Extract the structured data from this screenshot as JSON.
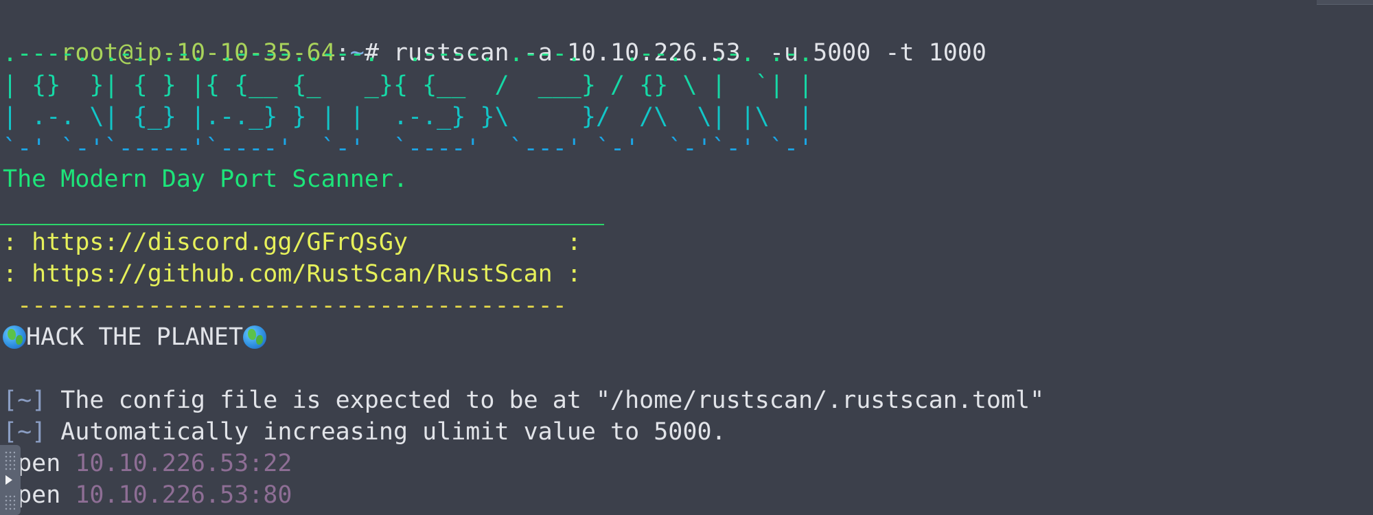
{
  "prompt": {
    "user_host": "root@ip-10-10-35-64",
    "separator": ":",
    "path": "~",
    "symbol": "# ",
    "command": "rustscan -a 10.10.226.53  -u 5000 -t 1000"
  },
  "banner": {
    "lines": [
      ".----. .-. .-. .----..---.  .----. .---.   .--.  .-. .-.",
      "| {}  }| { } |{ {__ {_   _}{ {__  /  ___} / {} \\ |  `| |",
      "| .-. \\| {_} |.-._} } | |  .-._} }\\     }/  /\\  \\| |\\  |",
      "`-' `-'`-----'`----'  `-'  `----'  `---' `-'  `-'`-' `-'"
    ],
    "colors": [
      "#1fe38a",
      "#16d8a6",
      "#12c6c8",
      "#1ba6e6"
    ]
  },
  "tagline": "The Modern Day Port Scanner.",
  "links": {
    "discord": ": https://discord.gg/GFrQsGy           :",
    "github": ": https://github.com/RustScan/RustScan :",
    "dashes": " --------------------------------------"
  },
  "hack": {
    "left_icon": "globe-icon",
    "text": "HACK THE PLANET",
    "right_icon": "globe-icon"
  },
  "messages": [
    {
      "tag": "[~]",
      "text": " The config file is expected to be at \"/home/rustscan/.rustscan.toml\""
    },
    {
      "tag": "[~]",
      "text": " Automatically increasing ulimit value to 5000."
    }
  ],
  "open_ports": [
    {
      "word": "Open ",
      "addr": "10.10.226.53:22"
    },
    {
      "word": "Open ",
      "addr": "10.10.226.53:80"
    }
  ],
  "colors": {
    "background": "#3c404b",
    "prompt_user": "#a9d35b",
    "prompt_path": "#7fb3e8",
    "tagline": "#1de57a",
    "link_text": "#e6f05a",
    "open_addr": "#8e6e95"
  }
}
